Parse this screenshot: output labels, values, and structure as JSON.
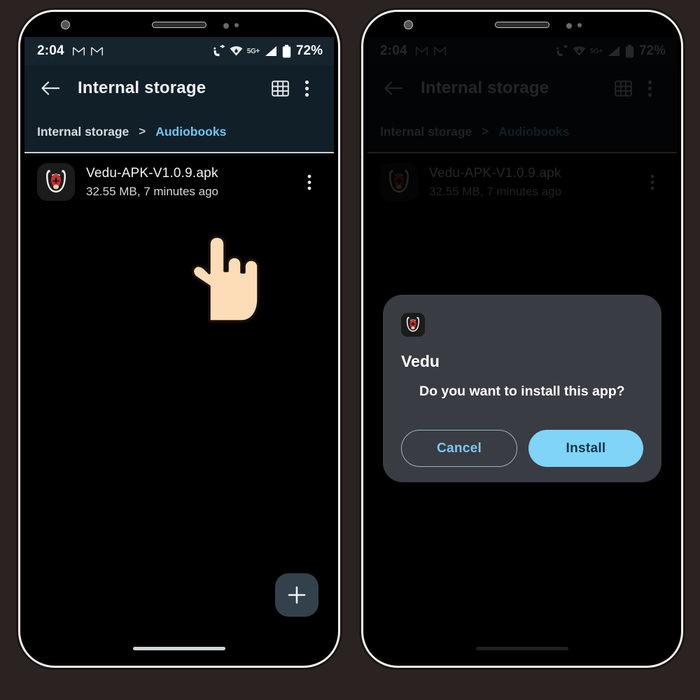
{
  "page": {
    "background_color": "#2a2321",
    "phone_count": 2
  },
  "status_bar": {
    "time": "2:04",
    "notification_icons": [
      "gmail-icon",
      "gmail-icon"
    ],
    "call_icon": "call-forward-icon",
    "wifi_icon": "wifi-icon",
    "network_label": "5G+",
    "signal_icon": "signal-bars-icon",
    "battery_icon": "battery-icon",
    "battery_percent": "72%"
  },
  "app_bar": {
    "back_icon": "back-arrow-icon",
    "title": "Internal storage",
    "grid_icon": "grid-view-icon",
    "overflow_icon": "more-vertical-icon"
  },
  "breadcrumb": {
    "root": "Internal storage",
    "separator": ">",
    "current": "Audiobooks",
    "current_color": "#6ec4f0"
  },
  "file_list": {
    "rows": [
      {
        "icon": "vedu-app-icon",
        "name": "Vedu-APK-V1.0.9.apk",
        "subtitle": "32.55 MB, 7 minutes ago",
        "overflow_icon": "more-vertical-icon"
      }
    ]
  },
  "fab": {
    "icon": "plus-icon",
    "label": "+",
    "color": "#33414c"
  },
  "dialog": {
    "icon": "vedu-app-icon",
    "title": "Vedu",
    "message": "Do you want to install this app?",
    "cancel_label": "Cancel",
    "install_label": "Install",
    "cancel_text_color": "#79c8f3",
    "install_bg_color": "#7fd4f7",
    "install_text_color": "#123444",
    "panel_color": "#393c42"
  },
  "cursor": {
    "icon": "pointing-hand-icon",
    "skin_color": "#fcddb7"
  },
  "home_indicator": {
    "icon": "home-indicator-bar"
  }
}
